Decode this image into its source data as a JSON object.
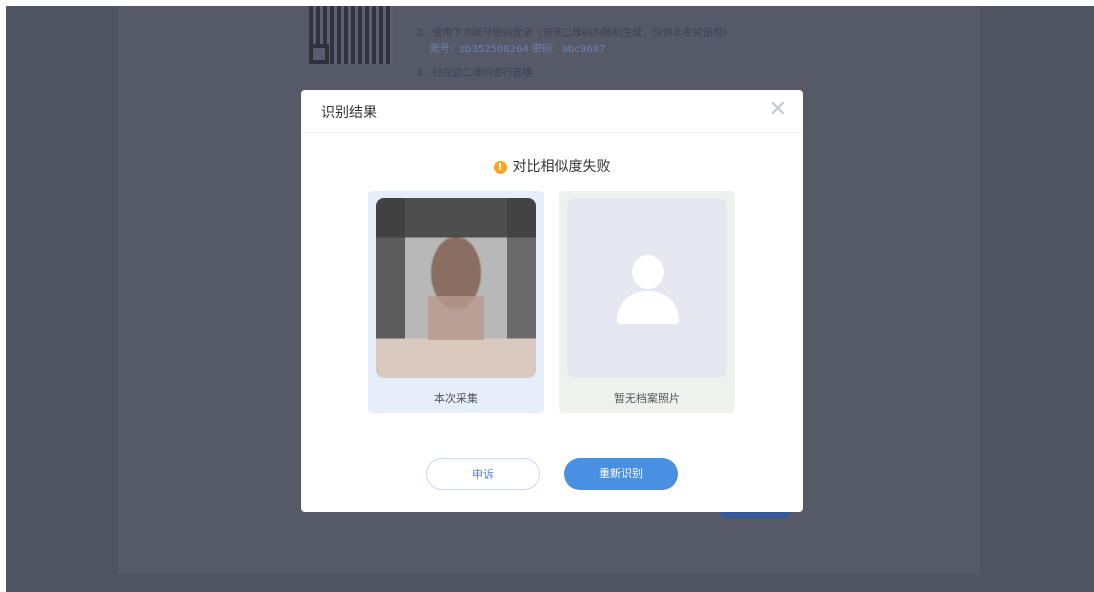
{
  "background_page": {
    "step2": "2、使用下方账号密码登录（但该二维码为随机生成，仅供本考试使用）",
    "account_line": "账号：zb352508264    密码：abc9687",
    "step3": "3、扫左边二维码进行直播"
  },
  "modal": {
    "title": "识别结果",
    "close_symbol": "✕",
    "status_icon": "!",
    "status_text": "对比相似度失败",
    "captured_label": "本次采集",
    "archive_label": "暂无档案照片",
    "appeal_button": "申诉",
    "retry_button": "重新识别"
  },
  "colors": {
    "overlay": "#4f5463",
    "primary": "#4a90e2",
    "warning": "#f5a623"
  }
}
